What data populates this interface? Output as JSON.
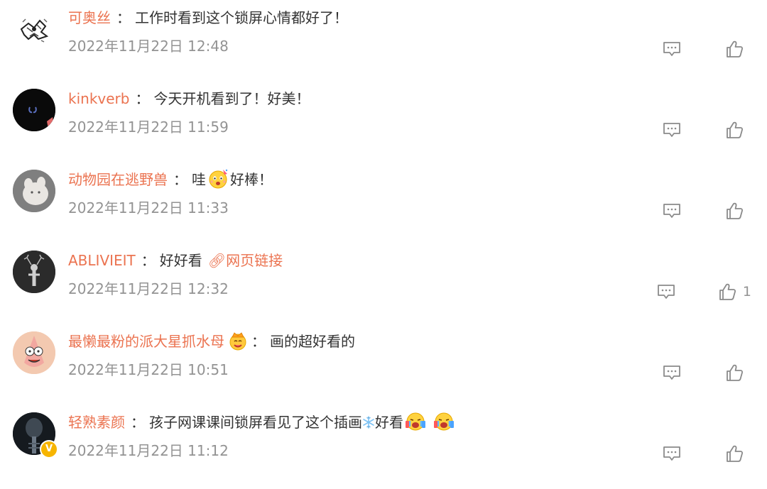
{
  "comments": [
    {
      "username": "可奥丝",
      "separator": "：",
      "text": "工作时看到这个锁屏心情都好了！",
      "time": "2022年11月22日 12:48",
      "avatar_icon": "sketch-avatar-icon",
      "like_count": ""
    },
    {
      "username": "kinkverb",
      "separator": "：",
      "text": "今天开机看到了！好美！",
      "time": "2022年11月22日 11:59",
      "avatar_icon": "dark-avatar-icon",
      "like_count": ""
    },
    {
      "username": "动物园在逃野兽",
      "separator": "：",
      "text_before": "哇",
      "emoji": "party-face-emoji",
      "text_after": "好棒！",
      "time": "2022年11月22日 11:33",
      "avatar_icon": "white-animal-avatar-icon",
      "like_count": ""
    },
    {
      "username": "ABLIVIEIT",
      "separator": "：",
      "text": "好好看",
      "link_text": "网页链接",
      "link_icon": "link-icon",
      "time": "2022年11月22日 12:32",
      "avatar_icon": "deer-avatar-icon",
      "like_count": "1"
    },
    {
      "username": "最懒最粉的派大星抓水母",
      "badge_icon": "crown-face-icon",
      "separator": "：",
      "text": "画的超好看的",
      "time": "2022年11月22日 10:51",
      "avatar_icon": "patrick-avatar-icon",
      "like_count": ""
    },
    {
      "username": "轻熟素颜",
      "separator": "：",
      "text_before": "孩子网课课间锁屏看见了这个插画",
      "snow_icon": "snowflake-icon",
      "text_after": "好看",
      "emoji": "crying-cheer-emoji",
      "verified_label": "V",
      "time": "2022年11月22日 11:12",
      "avatar_icon": "xray-avatar-icon",
      "like_count": ""
    }
  ],
  "colors": {
    "username": "#eb7350",
    "body_text": "#333333",
    "timestamp": "#939393",
    "icon_stroke": "#8a8a8a",
    "verified_badge": "#f7b500"
  }
}
